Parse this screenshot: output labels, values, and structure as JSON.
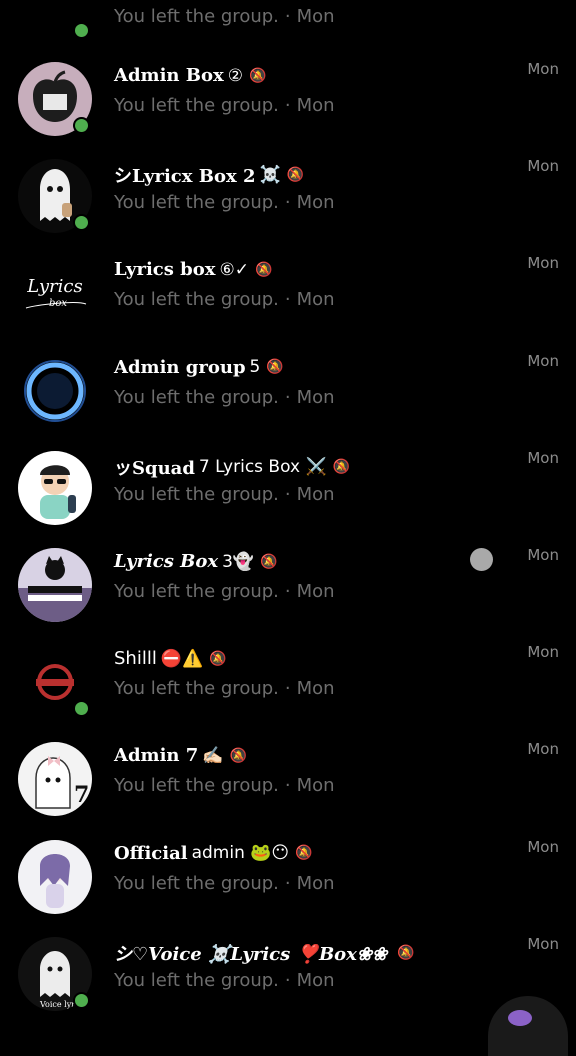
{
  "top_partial": {
    "subtitle": "You left the group.",
    "sep": "·",
    "day": "Mon"
  },
  "chats": [
    {
      "name": "Admin Box",
      "suffix": "②",
      "style": "bold",
      "emoji": "",
      "subtitle": "You left the group.",
      "sep": "·",
      "day": "Mon",
      "time": "Mon",
      "online": true,
      "avatar": "apple-avatar"
    },
    {
      "name": "シLyricx Box 2",
      "suffix": "☠️",
      "style": "bold",
      "emoji": "",
      "subtitle": "You left the group.",
      "sep": "·",
      "day": "Mon",
      "time": "Mon",
      "online": true,
      "avatar": "ghost-avatar"
    },
    {
      "name": "Lyrics box",
      "suffix": "⑥✓",
      "style": "bold",
      "emoji": "",
      "subtitle": "You left the group.",
      "sep": "·",
      "day": "Mon",
      "time": "Mon",
      "online": false,
      "avatar": "lyrics-logo-avatar"
    },
    {
      "name": "Admin group",
      "suffix": "5",
      "style": "bold",
      "emoji": "",
      "subtitle": "You left the group.",
      "sep": "·",
      "day": "Mon",
      "time": "Mon",
      "online": false,
      "avatar": "blue-ring-avatar"
    },
    {
      "name": "ッSquad",
      "suffix": "7 Lyrics Box ⚔️",
      "style": "bold",
      "emoji": "",
      "subtitle": "You left the group.",
      "sep": "·",
      "day": "Mon",
      "time": "Mon",
      "online": false,
      "avatar": "cartoon-boy-avatar"
    },
    {
      "name": "Lyrics Box",
      "suffix": "3👻",
      "style": "italic",
      "emoji": "",
      "subtitle": "You left the group.",
      "sep": "·",
      "day": "Mon",
      "time": "Mon",
      "online": false,
      "avatar": "cat-squad-avatar"
    },
    {
      "name": "Shilll",
      "suffix": "⛔⚠️",
      "style": "plain",
      "emoji": "",
      "subtitle": "You left the group.",
      "sep": "·",
      "day": "Mon",
      "time": "Mon",
      "online": true,
      "avatar": "red-badge-avatar"
    },
    {
      "name": "Admin 7",
      "suffix": "✍🏻",
      "style": "bold",
      "emoji": "",
      "subtitle": "You left the group.",
      "sep": "·",
      "day": "Mon",
      "time": "Mon",
      "online": false,
      "avatar": "bow-ghost-avatar"
    },
    {
      "name": "Official",
      "suffix": "admin 🐸😶",
      "style": "bold",
      "emoji": "",
      "subtitle": "You left the group.",
      "sep": "·",
      "day": "Mon",
      "time": "Mon",
      "online": false,
      "avatar": "anime-girl-avatar"
    },
    {
      "name": "シ♡Voice ☠️Lyrics ❣️Box❀❀",
      "suffix": "",
      "style": "italic",
      "emoji": "",
      "subtitle": "You left the group.",
      "sep": "·",
      "day": "Mon",
      "time": "Mon",
      "online": true,
      "avatar": "voice-ghost-avatar"
    }
  ],
  "mute_icon": "bell-off-icon",
  "colors": {
    "online": "#4fae4e",
    "subtitle": "#6e6e6e",
    "time": "#8c8c8c"
  }
}
